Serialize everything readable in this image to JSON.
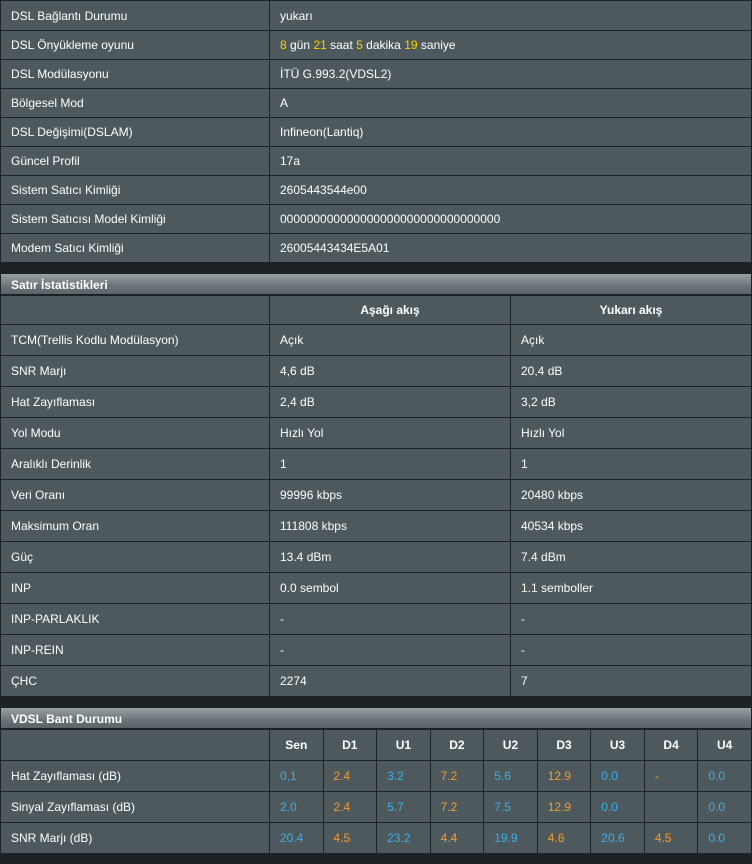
{
  "info": [
    {
      "key": "DSL Bağlantı Durumu",
      "value": "yukarı"
    },
    {
      "key": "DSL Önyükleme oyunu",
      "value": ""
    },
    {
      "key": "DSL Modülasyonu",
      "value": "İTÜ G.993.2(VDSL2)"
    },
    {
      "key": "Bölgesel Mod",
      "value": "A"
    },
    {
      "key": "DSL Değişimi(DSLAM)",
      "value": "Infineon(Lantiq)"
    },
    {
      "key": "Güncel Profil",
      "value": "17a"
    },
    {
      "key": "Sistem Satıcı Kimliği",
      "value": "2605443544e00"
    },
    {
      "key": "Sistem Satıcısı Model Kimliği",
      "value": "000000000000000000000000000000000"
    },
    {
      "key": "Modem Satıcı Kimliği",
      "value": "26005443434E5A01"
    }
  ],
  "uptime": {
    "days": "8",
    "days_label": "gün",
    "hours": "21",
    "hours_label": "saat",
    "minutes": "5",
    "minutes_label": "dakika",
    "seconds": "19",
    "seconds_label": "saniye"
  },
  "line_stats": {
    "title": "Satır İstatistikleri",
    "headers": [
      "",
      "Aşağı akış",
      "Yukarı akış"
    ],
    "rows": [
      {
        "key": "TCM(Trellis Kodlu Modülasyon)",
        "down": "Açık",
        "up": "Açık"
      },
      {
        "key": "SNR Marjı",
        "down": "4,6 dB",
        "up": "20,4 dB"
      },
      {
        "key": "Hat Zayıflaması",
        "down": "2,4 dB",
        "up": "3,2 dB"
      },
      {
        "key": "Yol Modu",
        "down": "Hızlı Yol",
        "up": "Hızlı Yol"
      },
      {
        "key": "Aralıklı Derinlik",
        "down": "1",
        "up": "1"
      },
      {
        "key": "Veri Oranı",
        "down": "99996 kbps",
        "up": "20480 kbps"
      },
      {
        "key": "Maksimum Oran",
        "down": "111808 kbps",
        "up": "40534 kbps"
      },
      {
        "key": "Güç",
        "down": "13.4 dBm",
        "up": "7.4 dBm"
      },
      {
        "key": "INP",
        "down": "0.0 sembol",
        "up": "1.1 semboller"
      },
      {
        "key": "INP-PARLAKLIK",
        "down": "-",
        "up": "-"
      },
      {
        "key": "INP-REIN",
        "down": "-",
        "up": "-"
      },
      {
        "key": "ÇHC",
        "down": "2274",
        "up": "7"
      }
    ]
  },
  "vdsl_band": {
    "title": "VDSL Bant Durumu",
    "headers": [
      "Sen",
      "D1",
      "U1",
      "D2",
      "U2",
      "D3",
      "U3",
      "D4",
      "U4"
    ],
    "rows": [
      {
        "key": "Hat Zayıflaması (dB)",
        "values": [
          "0,1",
          "2.4",
          "3.2",
          "7.2",
          "5.6",
          "12.9",
          "0.0",
          "-",
          "0.0"
        ]
      },
      {
        "key": "Sinyal Zayıflaması (dB)",
        "values": [
          "2.0",
          "2.4",
          "5.7",
          "7.2",
          "7.5",
          "12.9",
          "0.0",
          "",
          "0.0"
        ]
      },
      {
        "key": "SNR Marjı (dB)",
        "values": [
          "20.4",
          "4.5",
          "23.2",
          "4.4",
          "19.9",
          "4.6",
          "20.6",
          "4.5",
          "0.0"
        ]
      }
    ],
    "colors": {
      "up": "#3dafe8",
      "down": "#f39c2a"
    }
  }
}
